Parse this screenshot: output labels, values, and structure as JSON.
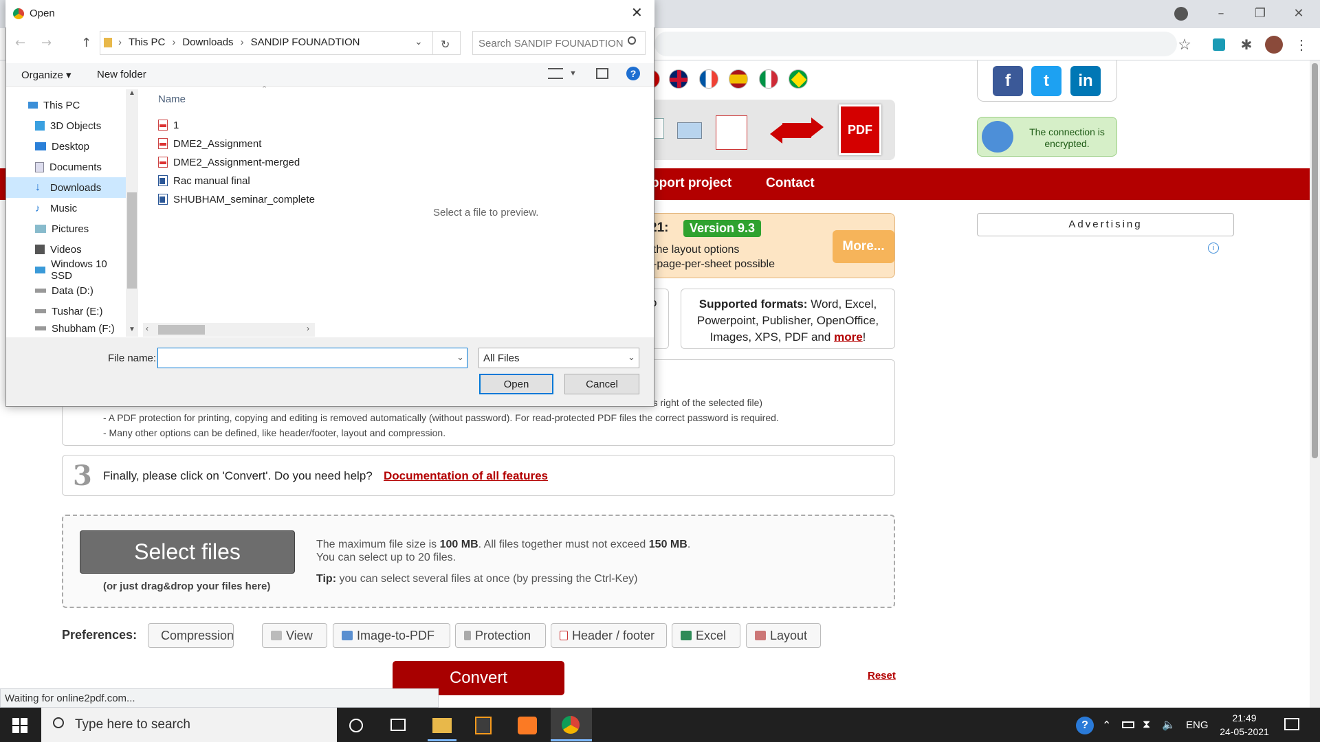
{
  "dialog": {
    "title": "Open",
    "breadcrumb": [
      "This PC",
      "Downloads",
      "SANDIP FOUNADTION"
    ],
    "search_placeholder": "Search SANDIP FOUNADTION",
    "organize_label": "Organize",
    "new_folder_label": "New folder",
    "column_name": "Name",
    "nav_items": [
      "This PC",
      "3D Objects",
      "Desktop",
      "Documents",
      "Downloads",
      "Music",
      "Pictures",
      "Videos",
      "Windows 10 SSD",
      "Data (D:)",
      "Tushar (E:)",
      "Shubham (F:)"
    ],
    "selected_nav": "Downloads",
    "files": [
      {
        "name": "1",
        "type": "pdf"
      },
      {
        "name": "DME2_Assignment",
        "type": "pdf"
      },
      {
        "name": "DME2_Assignment-merged",
        "type": "pdf"
      },
      {
        "name": "Rac manual final",
        "type": "word"
      },
      {
        "name": "SHUBHAM_seminar_complete",
        "type": "word"
      }
    ],
    "preview_text": "Select a file to preview.",
    "file_name_label": "File name:",
    "file_name_value": "",
    "filter_value": "All Files",
    "open_label": "Open",
    "cancel_label": "Cancel"
  },
  "site": {
    "nav": {
      "support": "pport project",
      "contact": "Contact"
    },
    "connection_text_1": "The connection is",
    "connection_text_2": "encrypted.",
    "advertising": "Advertising",
    "news_year_fragment": "21:",
    "version_label": "Version 9.3",
    "news_line_1": "the layout options",
    "news_line_2": "-page-per-sheet possible",
    "more_label": "More...",
    "formats_bold": "Supported formats:",
    "formats_text": "Word, Excel, Powerpoint, Publisher, OpenOffice, Images, XPS, PDF and",
    "formats_more": "more",
    "formats_end": "!",
    "left_box_fragment": "o",
    "step2_line_0": "ons right of the selected file)",
    "step2_line_1": "- A PDF protection for printing, copying and editing is removed automatically (without password). For read-protected PDF files the correct password is required.",
    "step2_line_2": "- Many other options can be defined, like header/footer, layout and compression.",
    "step3_number": "3",
    "step3_text": "Finally, please click on 'Convert'. Do you need help?",
    "step3_link": "Documentation of all features",
    "select_files_label": "Select files",
    "drag_drop": "(or just drag&drop your files here)",
    "size_text_a": "The maximum file size is",
    "size_text_b": "100 MB",
    "size_text_c": ". All files together must not exceed",
    "size_text_d": "150 MB",
    "size_text_e": ".",
    "select_up_to": "You can select up to 20 files.",
    "tip_label": "Tip:",
    "tip_text": "you can select several files at once (by pressing the Ctrl-Key)",
    "preferences_label": "Preferences:",
    "pref_buttons": [
      "Compression",
      "View",
      "Image-to-PDF",
      "Protection",
      "Header / footer",
      "Excel",
      "Layout"
    ],
    "convert_label": "Convert",
    "reset_label": "Reset",
    "pdf_icon_label": "PDF",
    "social": [
      "f",
      "t",
      "in"
    ]
  },
  "browser": {
    "status_text": "Waiting for online2pdf.com..."
  },
  "taskbar": {
    "search_placeholder": "Type here to search",
    "language": "ENG",
    "time": "21:49",
    "date": "24-05-2021"
  },
  "colors": {
    "site_red": "#b30000",
    "version_green": "#2fa22f",
    "win_accent": "#0078d7"
  }
}
